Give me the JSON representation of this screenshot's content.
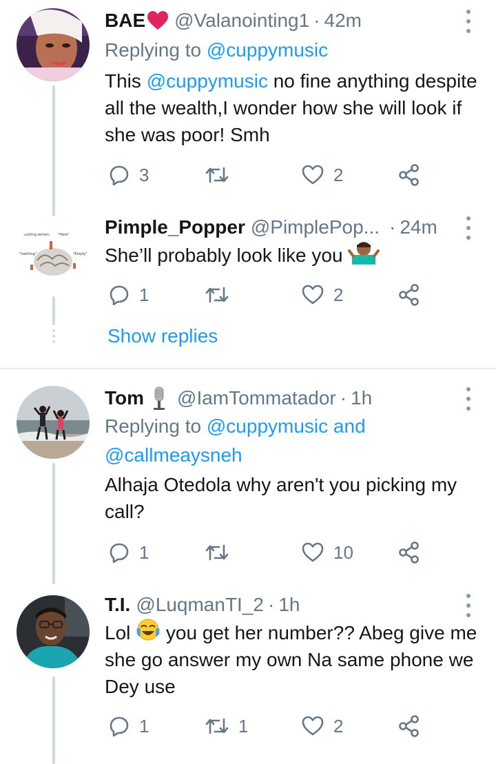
{
  "tweets": [
    {
      "name": "BAE",
      "handle": "@Valanointing1",
      "sep": "·",
      "time": "42m",
      "replying_prefix": "Replying to ",
      "replying_to": "@cuppymusic",
      "body_mention": "@cuppymusic",
      "body_pre": "This ",
      "body_post": " no fine anything despite all the wealth,I wonder how she will look if she was poor! Smh",
      "replies": "3",
      "retweets": "",
      "likes": "2"
    },
    {
      "name": "Pimple_Popper",
      "handle": "@PimplePop...",
      "sep": "·",
      "time": "24m",
      "body": "She’ll probably look like you",
      "replies": "1",
      "retweets": "",
      "likes": "2",
      "show_replies": "Show replies",
      "avatar_labels": [
        ".sucking semen..",
        "\"Here\"",
        "\"loathing\"",
        "\"Empty\""
      ]
    },
    {
      "name": "Tom",
      "handle": "@IamTommatador",
      "sep": "·",
      "time": "1h",
      "replying_prefix": "Replying to ",
      "replying_to": "@cuppymusic",
      "replying_and": " and",
      "replying_to_2": "@callmeaysneh",
      "body": "Alhaja Otedola why aren't you picking my call?",
      "replies": "1",
      "retweets": "",
      "likes": "10"
    },
    {
      "name": "T.I.",
      "handle": "@LuqmanTI_2",
      "sep": "·",
      "time": "1h",
      "body_pre": "Lol ",
      "body_post": " you get her number?? Abeg give me she go answer my own Na same phone we Dey use",
      "replies": "1",
      "retweets": "1",
      "likes": "2"
    }
  ],
  "icons": {
    "reply": "reply-icon",
    "retweet": "retweet-icon",
    "like": "heart-outline-icon",
    "share": "share-icon",
    "more": "more-vertical-icon"
  },
  "colors": {
    "link": "#1d9bf0",
    "secondary": "#657786",
    "thread_line": "#cfd9de",
    "heart_emoji": "#e0245e"
  }
}
